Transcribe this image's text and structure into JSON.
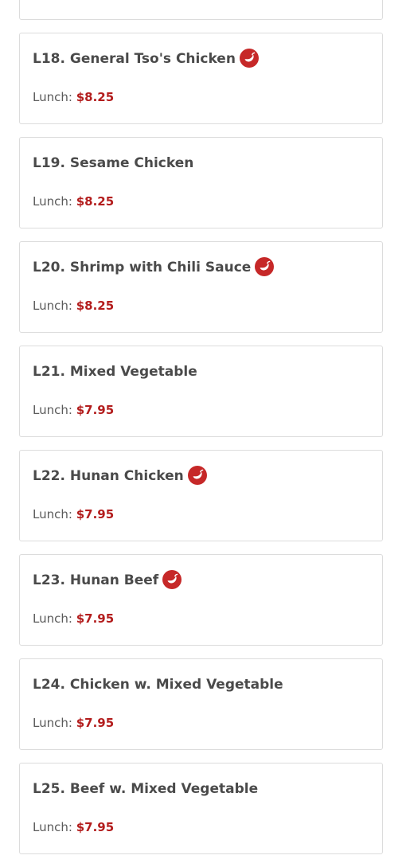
{
  "colors": {
    "title": "#4a4a4a",
    "price": "#b31d1d",
    "spicy_icon": "#c62828",
    "card_border": "#dcdcdc"
  },
  "items": [
    {
      "title": "L18. General Tso's Chicken",
      "spicy": true,
      "price_label": "Lunch:",
      "price": "$8.25"
    },
    {
      "title": "L19. Sesame Chicken",
      "spicy": false,
      "price_label": "Lunch:",
      "price": "$8.25"
    },
    {
      "title": "L20. Shrimp with Chili Sauce",
      "spicy": true,
      "price_label": "Lunch:",
      "price": "$8.25"
    },
    {
      "title": "L21. Mixed Vegetable",
      "spicy": false,
      "price_label": "Lunch:",
      "price": "$7.95"
    },
    {
      "title": "L22. Hunan Chicken",
      "spicy": true,
      "price_label": "Lunch:",
      "price": "$7.95"
    },
    {
      "title": "L23. Hunan Beef",
      "spicy": true,
      "price_label": "Lunch:",
      "price": "$7.95"
    },
    {
      "title": "L24. Chicken w. Mixed Vegetable",
      "spicy": false,
      "price_label": "Lunch:",
      "price": "$7.95"
    },
    {
      "title": "L25. Beef w. Mixed Vegetable",
      "spicy": false,
      "price_label": "Lunch:",
      "price": "$7.95"
    }
  ],
  "icons": {
    "spicy": "chili-pepper-icon"
  }
}
